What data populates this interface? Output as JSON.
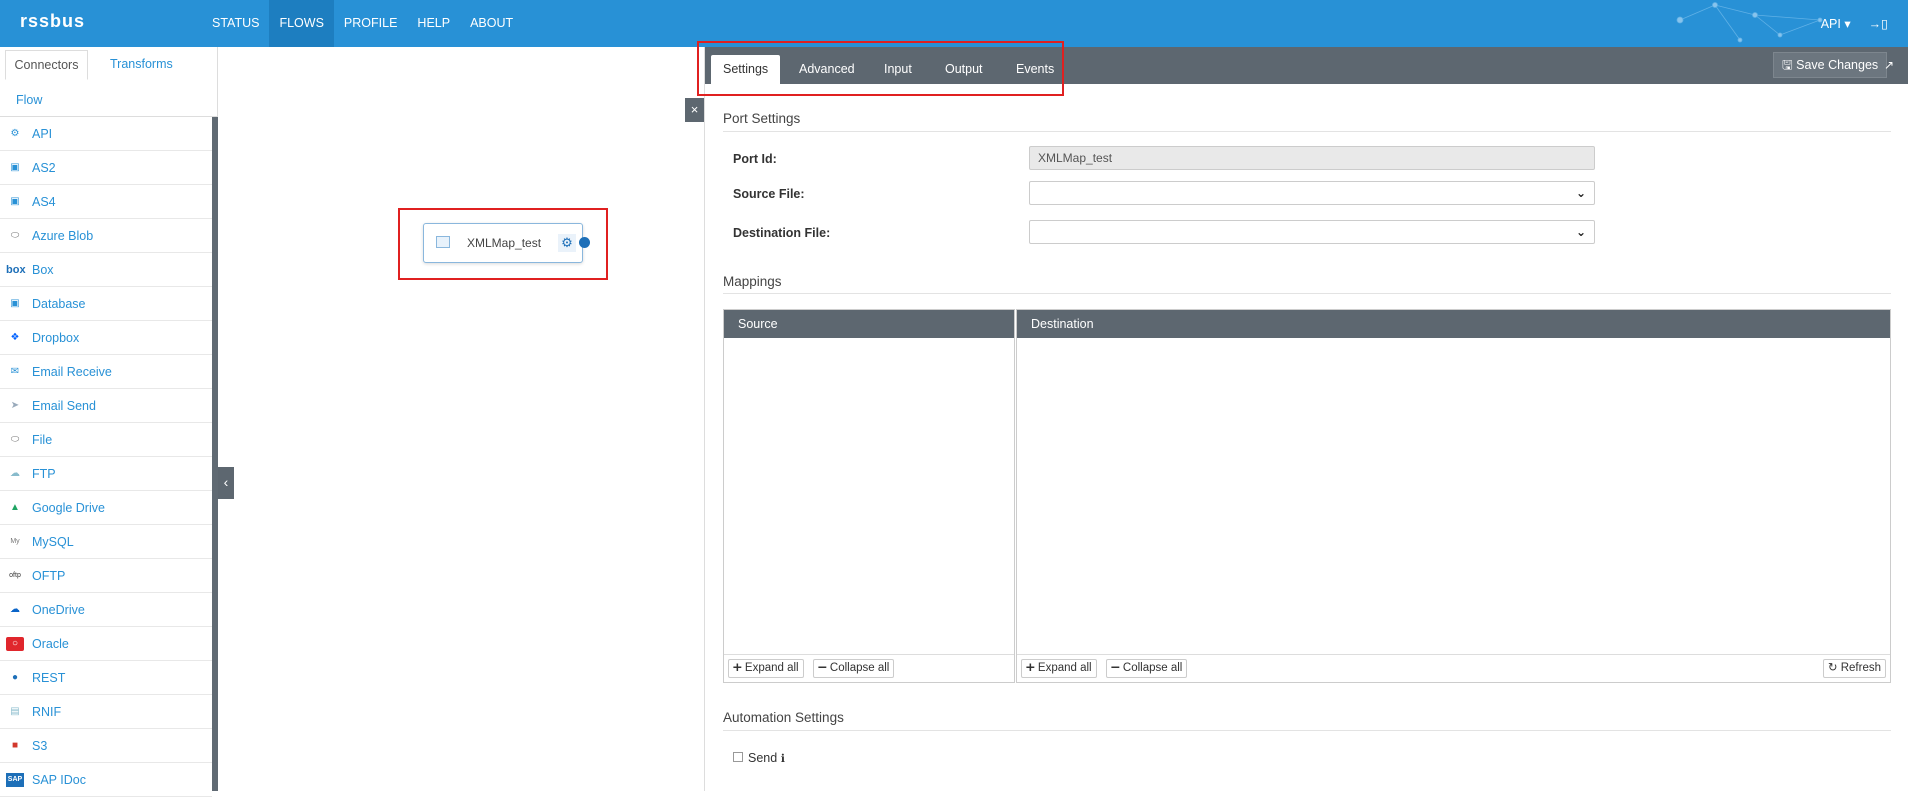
{
  "app": {
    "brand": "rssbus"
  },
  "nav": {
    "items": [
      "STATUS",
      "FLOWS",
      "PROFILE",
      "HELP",
      "ABOUT"
    ],
    "active": "FLOWS"
  },
  "topright": {
    "user_label": "API ▾"
  },
  "sidebar": {
    "tabs": [
      "Connectors",
      "Transforms",
      "Flow"
    ],
    "items": [
      {
        "label": "API",
        "icon": "api-icon"
      },
      {
        "label": "AS2",
        "icon": "as2-icon"
      },
      {
        "label": "AS4",
        "icon": "as4-icon"
      },
      {
        "label": "Azure Blob",
        "icon": "azure-blob-icon"
      },
      {
        "label": "Box",
        "icon": "box-icon"
      },
      {
        "label": "Database",
        "icon": "database-icon"
      },
      {
        "label": "Dropbox",
        "icon": "dropbox-icon"
      },
      {
        "label": "Email Receive",
        "icon": "email-receive-icon"
      },
      {
        "label": "Email Send",
        "icon": "email-send-icon"
      },
      {
        "label": "File",
        "icon": "file-icon"
      },
      {
        "label": "FTP",
        "icon": "ftp-icon"
      },
      {
        "label": "Google Drive",
        "icon": "google-drive-icon"
      },
      {
        "label": "MySQL",
        "icon": "mysql-icon"
      },
      {
        "label": "OFTP",
        "icon": "oftp-icon"
      },
      {
        "label": "OneDrive",
        "icon": "onedrive-icon"
      },
      {
        "label": "Oracle",
        "icon": "oracle-icon"
      },
      {
        "label": "REST",
        "icon": "rest-icon"
      },
      {
        "label": "RNIF",
        "icon": "rnif-icon"
      },
      {
        "label": "S3",
        "icon": "s3-icon"
      },
      {
        "label": "SAP IDoc",
        "icon": "sap-idoc-icon"
      }
    ]
  },
  "canvas": {
    "node_label": "XMLMap_test"
  },
  "panel": {
    "tabs": [
      "Settings",
      "Advanced",
      "Input",
      "Output",
      "Events"
    ],
    "active_tab": "Settings",
    "save_label": "Save Changes",
    "port_settings": {
      "title": "Port Settings",
      "port_id_label": "Port Id:",
      "port_id_value": "XMLMap_test",
      "source_file_label": "Source File:",
      "destination_file_label": "Destination File:"
    },
    "mappings": {
      "title": "Mappings",
      "source_header": "Source",
      "destination_header": "Destination",
      "expand_all": "Expand all",
      "collapse_all": "Collapse all",
      "refresh": "Refresh"
    },
    "automation": {
      "title": "Automation Settings",
      "send_label": "Send"
    }
  },
  "colors": {
    "topbar": "#2891d6",
    "panel_bar": "#5d6770",
    "highlight": "#e02020",
    "link": "#2891d6"
  }
}
